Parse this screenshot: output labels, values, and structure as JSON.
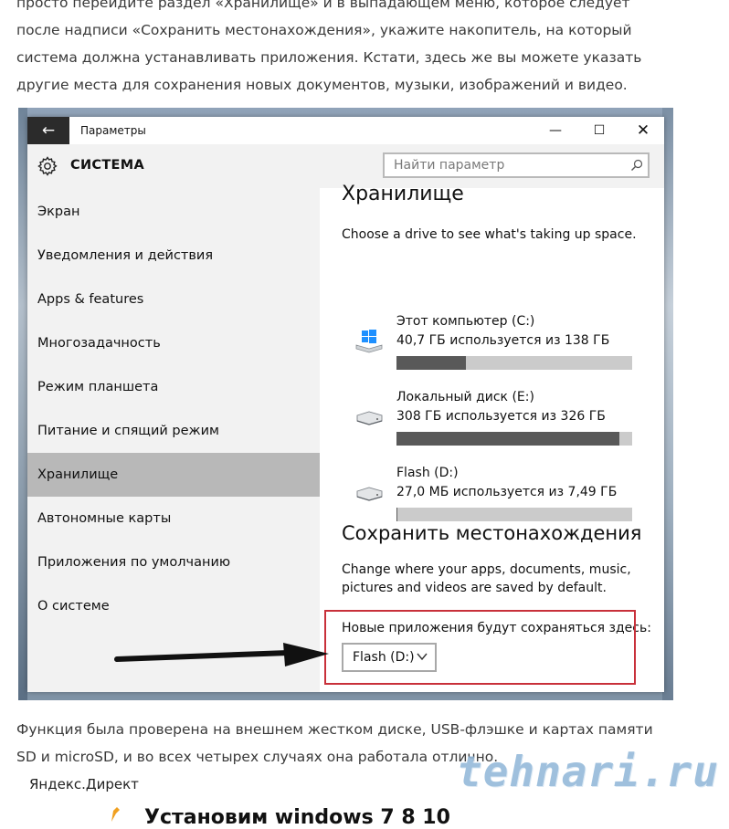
{
  "article": {
    "para_top": "просто перейдите раздел «Хранилище» и в выпадающем меню, которое следует после надписи «Сохранить местонахождения», укажите накопитель, на который система должна устанавливать приложения. Кстати, здесь же вы можете указать другие места для сохранения новых документов, музыки, изображений и видео.",
    "para_bottom": "Функция была проверена на внешнем жестком диске, USB-флэшке и картах памяти SD и microSD, и во всех четырех случаях она работала отлично.",
    "yandex_label": "Яндекс.Директ",
    "watermark": "tehnari.ru",
    "next_heading": "Установим windows 7 8 10"
  },
  "window": {
    "title": "Параметры",
    "back_glyph": "←",
    "min_glyph": "—",
    "max_glyph": "☐",
    "close_glyph": "✕"
  },
  "header": {
    "section_title": "СИСТЕМА",
    "search_placeholder": "Найти параметр"
  },
  "sidebar": {
    "items": [
      {
        "label": "Экран",
        "selected": false
      },
      {
        "label": "Уведомления и действия",
        "selected": false
      },
      {
        "label": "Apps & features",
        "selected": false
      },
      {
        "label": "Многозадачность",
        "selected": false
      },
      {
        "label": "Режим планшета",
        "selected": false
      },
      {
        "label": "Питание и спящий режим",
        "selected": false
      },
      {
        "label": "Хранилище",
        "selected": true
      },
      {
        "label": "Автономные карты",
        "selected": false
      },
      {
        "label": "Приложения по умолчанию",
        "selected": false
      },
      {
        "label": "О системе",
        "selected": false
      }
    ]
  },
  "storage": {
    "heading": "Хранилище",
    "subtitle": "Choose a drive to see what's taking up space.",
    "drives": [
      {
        "name": "Этот компьютер (C:)",
        "usage": "40,7 ГБ используется из 138 ГБ",
        "fraction": 0.295,
        "icon": "windows-drive-icon"
      },
      {
        "name": "Локальный диск (E:)",
        "usage": "308 ГБ используется из 326 ГБ",
        "fraction": 0.945,
        "icon": "hard-drive-icon"
      },
      {
        "name": "Flash (D:)",
        "usage": "27,0 МБ используется из 7,49 ГБ",
        "fraction": 0.0035,
        "icon": "flash-drive-icon"
      }
    ]
  },
  "save_locations": {
    "heading": "Сохранить местонахождения",
    "description": "Change where your apps, documents, music, pictures and videos are saved by default.",
    "new_apps_label": "Новые приложения будут сохраняться здесь:",
    "new_apps_value": "Flash (D:)"
  },
  "colors": {
    "selected_nav": "#b8b8b8",
    "bar_fill": "#595959",
    "bar_bg": "#cbcbcb",
    "highlight_box": "#c8303a",
    "accent_windows": "#1e90ff"
  }
}
